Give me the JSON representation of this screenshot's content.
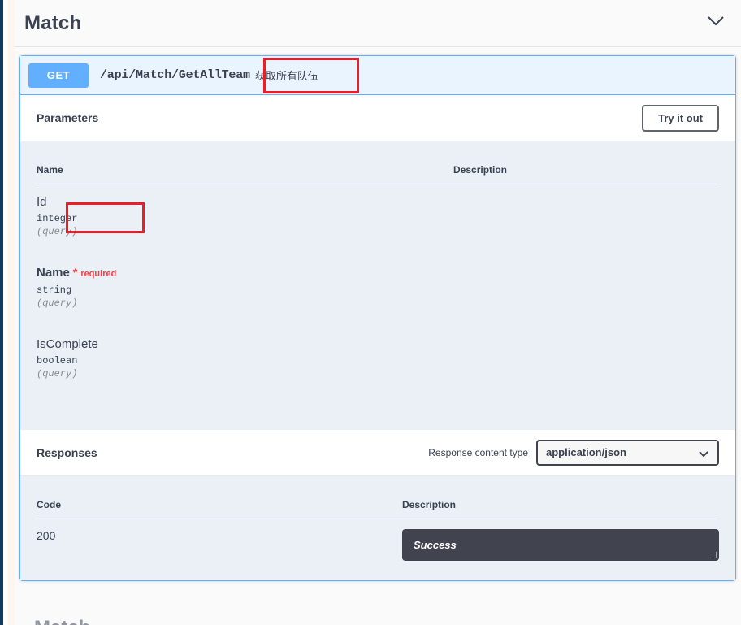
{
  "tag": {
    "title": "Match",
    "collapse_icon": "chevron-down-icon"
  },
  "operation": {
    "method": "GET",
    "path": "/api/Match/GetAllTeam",
    "summary": "获取所有队伍"
  },
  "parameters_section": {
    "title": "Parameters",
    "try_it_out_label": "Try it out",
    "columns": {
      "name": "Name",
      "description": "Description"
    },
    "rows": [
      {
        "name": "Id",
        "type": "integer",
        "in": "(query)",
        "required": false,
        "required_star": "",
        "required_label": "",
        "description": ""
      },
      {
        "name": "Name",
        "type": "string",
        "in": "(query)",
        "required": true,
        "required_star": "*",
        "required_label": "required",
        "description": ""
      },
      {
        "name": "IsComplete",
        "type": "boolean",
        "in": "(query)",
        "required": false,
        "required_star": "",
        "required_label": "",
        "description": ""
      }
    ]
  },
  "responses_section": {
    "title": "Responses",
    "content_type_label": "Response content type",
    "content_type_value": "application/json",
    "content_type_icon": "chevron-down-icon",
    "columns": {
      "code": "Code",
      "description": "Description"
    },
    "rows": [
      {
        "code": "200",
        "description": "Success"
      }
    ]
  },
  "next_tag_peek": "Match",
  "colors": {
    "get_method": "#61affe",
    "opblock_border": "#61affe",
    "opblock_bg": "#eaf4fe",
    "params_bg": "#eaf0f6",
    "annotation_red": "#ee1c25",
    "required_red": "#f93e3e",
    "code_block_bg": "#41444e",
    "text_primary": "#3b4151"
  }
}
